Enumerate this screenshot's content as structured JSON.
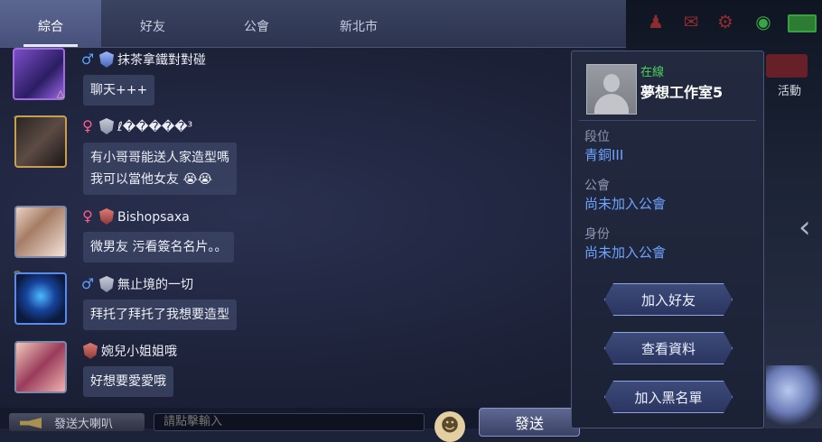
{
  "tabs": [
    {
      "label": "綜合",
      "active": true
    },
    {
      "label": "好友",
      "active": false
    },
    {
      "label": "公會",
      "active": false
    },
    {
      "label": "新北市",
      "active": false
    }
  ],
  "side": {
    "activity_label": "活動"
  },
  "messages": [
    {
      "name": "抹茶拿鐵對對碰",
      "gender": "male",
      "text_lines": [
        "聊天+++"
      ]
    },
    {
      "name": "ℓ�����³",
      "gender": "female",
      "text_lines": [
        "有小哥哥能送人家造型嗎",
        "我可以當他女友 😭😭"
      ]
    },
    {
      "name": "Bishopsaxa",
      "gender": "female",
      "text_lines": [
        "微男友  污看簽名名片。。"
      ]
    },
    {
      "name": "無止境的一切",
      "gender": "male",
      "text_lines": [
        "拜托了拜托了我想要造型"
      ]
    },
    {
      "name": "婉兒小姐姐哦",
      "gender": "",
      "text_lines": [
        "好想要愛愛哦"
      ]
    }
  ],
  "bottom": {
    "horn_label": "發送大喇叭",
    "input_placeholder": "請點擊輸入",
    "send_label": "發送"
  },
  "profile": {
    "status": "在線",
    "name": "夢想工作室5",
    "fields": [
      {
        "label": "段位",
        "value": "青銅III"
      },
      {
        "label": "公會",
        "value": "尚未加入公會"
      },
      {
        "label": "身份",
        "value": "尚未加入公會"
      }
    ],
    "buttons": [
      "加入好友",
      "查看資料",
      "加入黑名單"
    ]
  },
  "colors": {
    "online": "#4bd35a",
    "value_link": "#6ea3ff",
    "male": "#5aa0ff",
    "female": "#ff5b8e"
  }
}
